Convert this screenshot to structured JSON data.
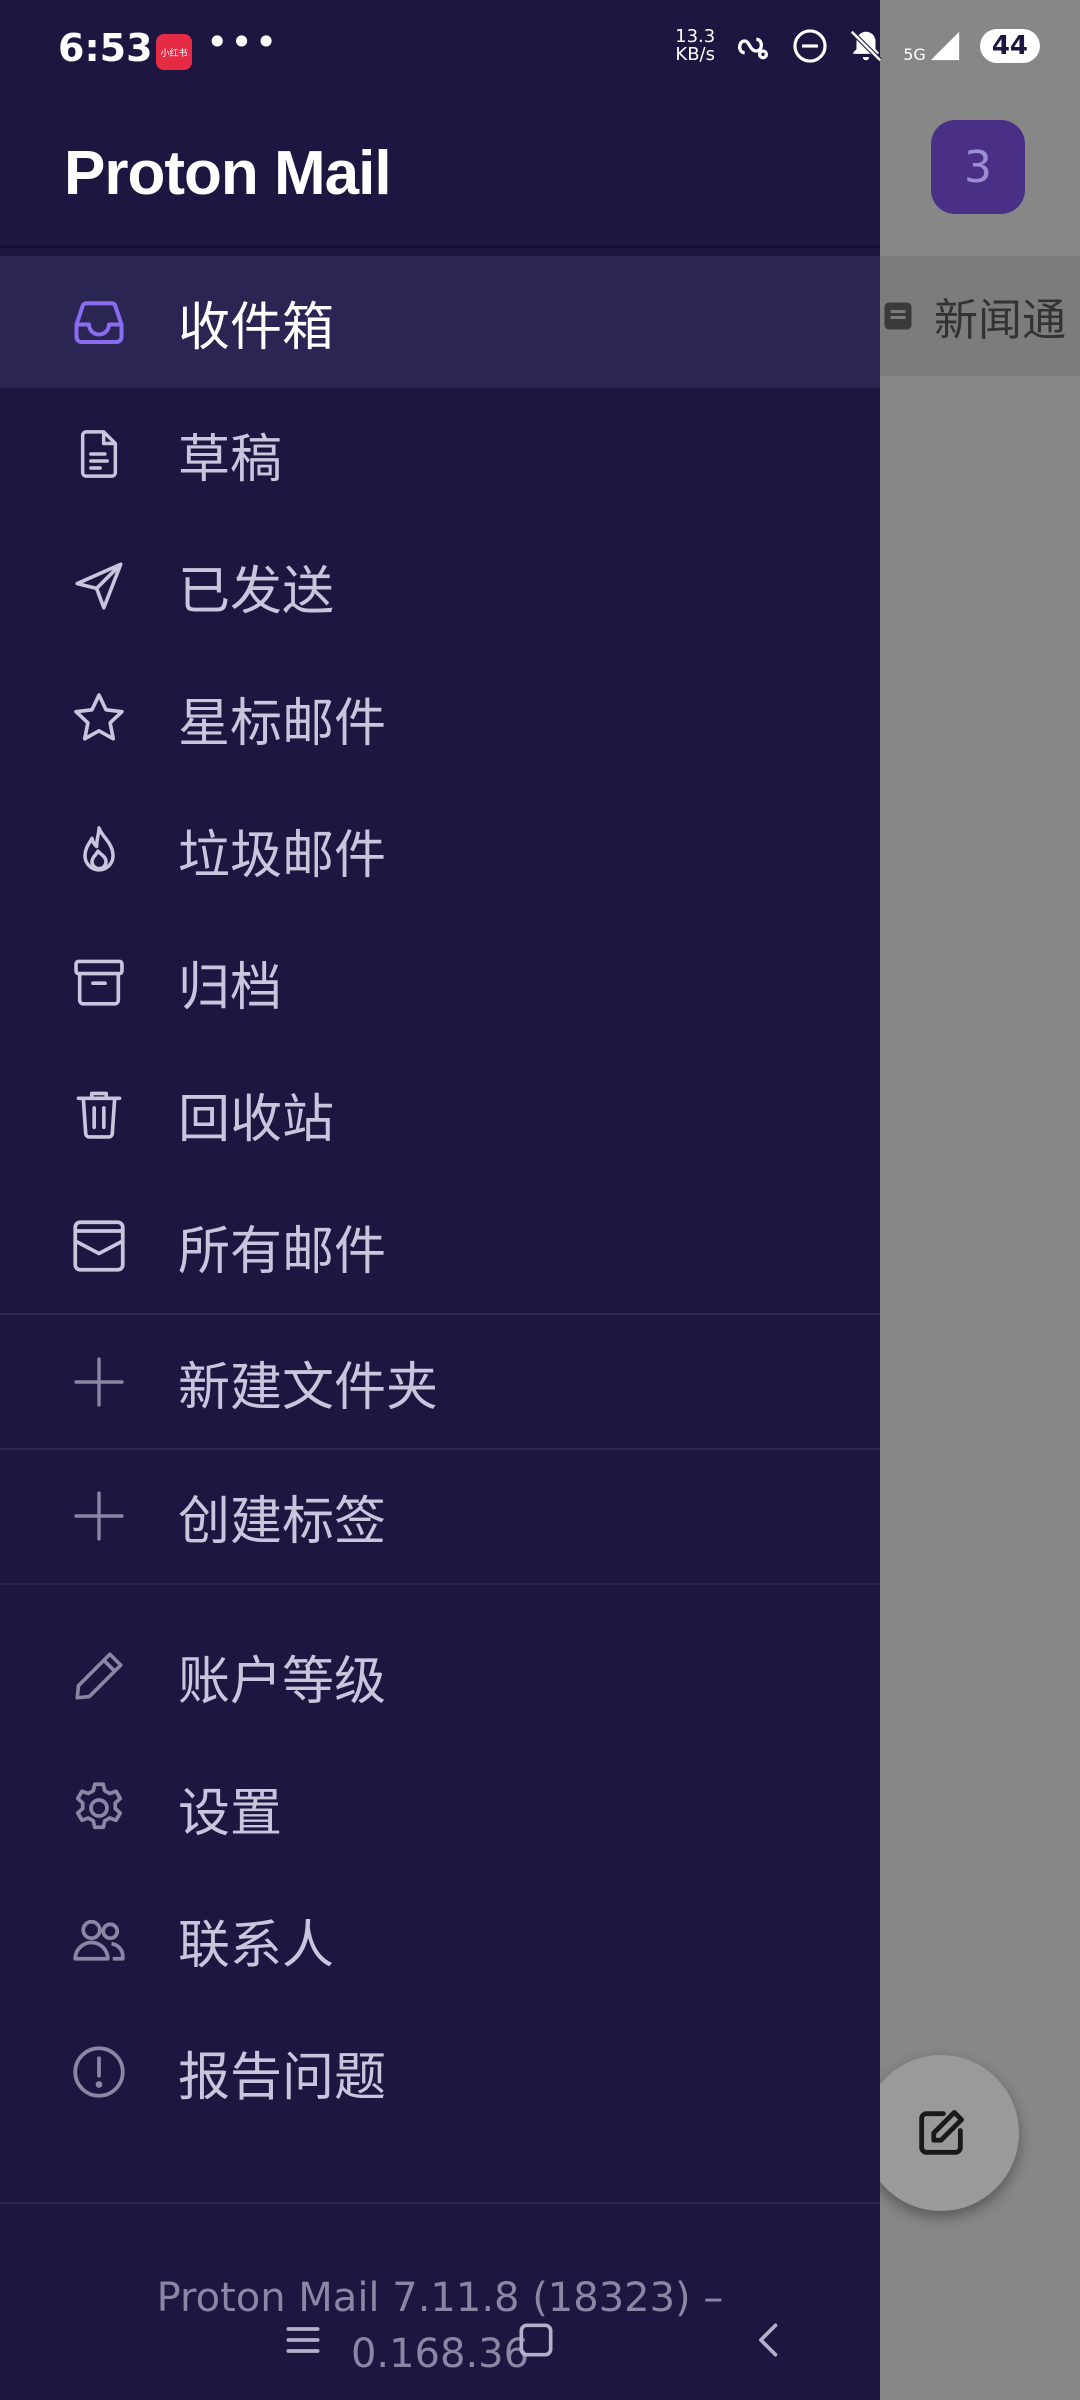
{
  "status_bar": {
    "time": "6:53",
    "app_badge": "小红书",
    "dots": "•••",
    "net_speed_value": "13.3",
    "net_speed_unit": "KB/s",
    "network": "5G",
    "battery": "44"
  },
  "drawer": {
    "brand": "Proton Mail",
    "items": [
      {
        "label": "收件箱",
        "icon": "inbox-icon"
      },
      {
        "label": "草稿",
        "icon": "draft-icon"
      },
      {
        "label": "已发送",
        "icon": "send-icon"
      },
      {
        "label": "星标邮件",
        "icon": "star-icon"
      },
      {
        "label": "垃圾邮件",
        "icon": "spam-icon"
      },
      {
        "label": "归档",
        "icon": "archive-icon"
      },
      {
        "label": "回收站",
        "icon": "trash-icon"
      },
      {
        "label": "所有邮件",
        "icon": "all-mail-icon"
      }
    ],
    "actions": [
      {
        "label": "新建文件夹",
        "icon": "plus-icon"
      },
      {
        "label": "创建标签",
        "icon": "plus-icon"
      }
    ],
    "more": [
      {
        "label": "账户等级",
        "icon": "pencil-icon"
      },
      {
        "label": "设置",
        "icon": "gear-icon"
      },
      {
        "label": "联系人",
        "icon": "contacts-icon"
      },
      {
        "label": "报告问题",
        "icon": "alert-icon"
      }
    ],
    "version_line1": "Proton Mail 7.11.8 (18323) –",
    "version_line2": "0.168.36"
  },
  "background": {
    "avatar_text": "3",
    "row_text": "新闻通"
  },
  "colors": {
    "drawer_bg": "#1c1640",
    "active_item_bg": "#2b2553",
    "accent": "#8a6cf0"
  }
}
